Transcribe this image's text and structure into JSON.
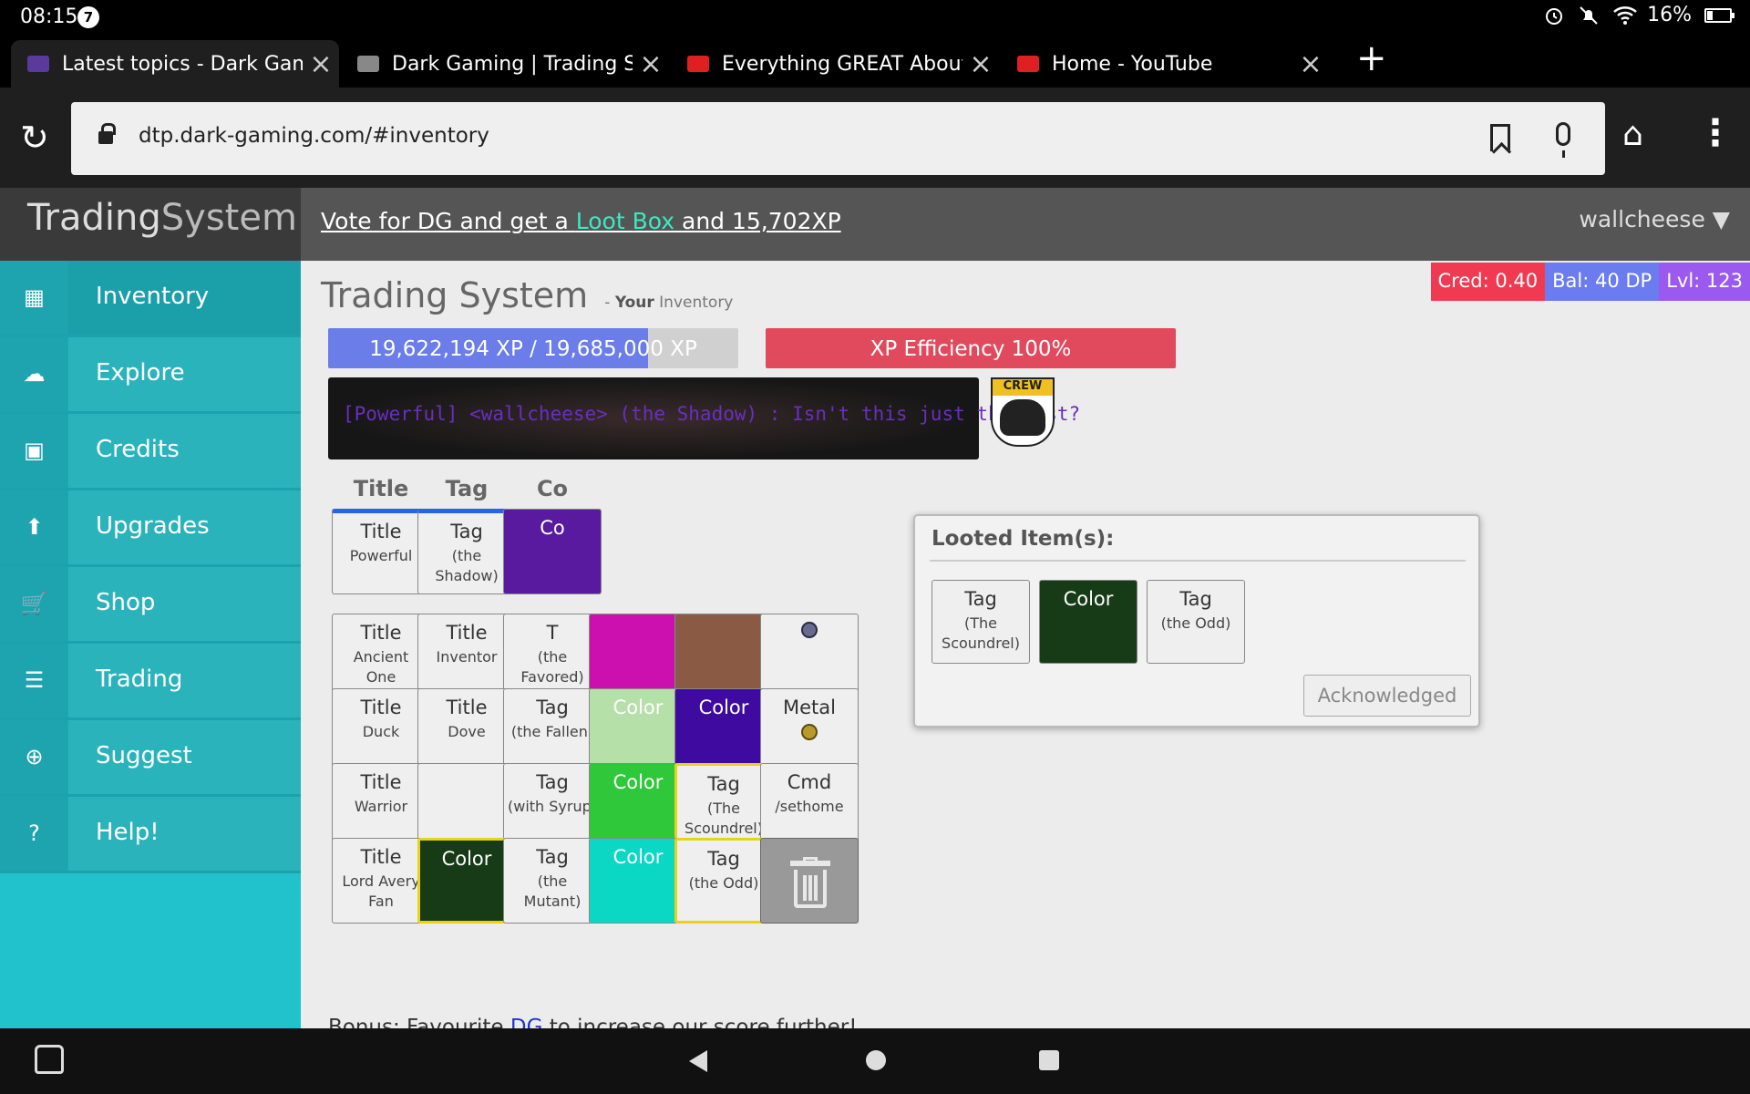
{
  "status": {
    "time": "08:15",
    "notif_count": "7",
    "battery": "16%"
  },
  "tabs": [
    {
      "title": "Latest topics - Dark Gaming",
      "fav_color": "#5a3a9a"
    },
    {
      "title": "Dark Gaming | Trading System",
      "fav_color": "#888888"
    },
    {
      "title": "Everything GREAT About Johnny",
      "fav_color": "#e02020"
    },
    {
      "title": "Home - YouTube",
      "fav_color": "#e02020"
    }
  ],
  "url": "dtp.dark-gaming.com/#inventory",
  "brand": {
    "part1": "Trading",
    "part2": "System"
  },
  "vote": {
    "pre": "Vote for DG and get a ",
    "loot": "Loot Box",
    "post": " and 15,702XP"
  },
  "user": "wallcheese ▼",
  "badges": [
    {
      "text": "Cred: 0.40",
      "color": "#f03a52"
    },
    {
      "text": "Bal: 40 DP",
      "color": "#6a7cf0"
    },
    {
      "text": "Lvl: 123",
      "color": "#9a5af0"
    }
  ],
  "heading": {
    "title": "Trading System",
    "dash": "- ",
    "your": "Your",
    "sub": " Inventory"
  },
  "nav": [
    {
      "label": "Inventory",
      "icon": "▦"
    },
    {
      "label": "Explore",
      "icon": "☁"
    },
    {
      "label": "Credits",
      "icon": "▣"
    },
    {
      "label": "Upgrades",
      "icon": "⬆"
    },
    {
      "label": "Shop",
      "icon": "🛒"
    },
    {
      "label": "Trading",
      "icon": "☰"
    },
    {
      "label": "Suggest",
      "icon": "⊕"
    },
    {
      "label": "Help!",
      "icon": "?"
    }
  ],
  "xp": {
    "text": "19,622,194 XP / 19,685,000 XP",
    "progress": 0.78
  },
  "efficiency": "XP Efficiency 100%",
  "chat": "[Powerful] <wallcheese> (the Shadow) : Isn't this just the best?",
  "crew_label": "CREW",
  "columns": [
    "Title",
    "Tag",
    "Co"
  ],
  "equipped": [
    {
      "l1": "Title",
      "l2": "Powerful"
    },
    {
      "l1": "Tag",
      "l2": "(the Shadow)"
    },
    {
      "l1": "Co",
      "l2": "",
      "bg": "#5a1aa0"
    }
  ],
  "grid": [
    [
      {
        "l1": "Title",
        "l2": "Ancient One"
      },
      {
        "l1": "Title",
        "l2": "Inventor"
      },
      {
        "l1": "T",
        "l2": "(the Favored)"
      },
      {
        "l1": "",
        "l2": "",
        "bg": "#cc10b0"
      },
      {
        "l1": "",
        "l2": "",
        "bg": "#8a5a44"
      },
      {
        "l1": "",
        "l2": "",
        "metal": "blue"
      }
    ],
    [
      {
        "l1": "Title",
        "l2": "Duck"
      },
      {
        "l1": "Title",
        "l2": "Dove"
      },
      {
        "l1": "Tag",
        "l2": "(the Fallen)"
      },
      {
        "l1": "Color",
        "l2": "",
        "bg": "#b5e0a8"
      },
      {
        "l1": "Color",
        "l2": "",
        "bg": "#3f0aa0"
      },
      {
        "l1": "Metal",
        "l2": "",
        "metal": "gold"
      }
    ],
    [
      {
        "l1": "Title",
        "l2": "Warrior"
      },
      {
        "l1": "",
        "l2": ""
      },
      {
        "l1": "Tag",
        "l2": "(with Syrup)"
      },
      {
        "l1": "Color",
        "l2": "",
        "bg": "#2ec83a"
      },
      {
        "l1": "Tag",
        "l2": "(The Scoundrel)",
        "gold": true
      },
      {
        "l1": "Cmd",
        "l2": "/sethome"
      }
    ],
    [
      {
        "l1": "Title",
        "l2": "Lord Avery Fan"
      },
      {
        "l1": "Color",
        "l2": "",
        "bg": "#173a17",
        "gold": true
      },
      {
        "l1": "Tag",
        "l2": "(the Mutant)"
      },
      {
        "l1": "Color",
        "l2": "",
        "bg": "#0ad8c4"
      },
      {
        "l1": "Tag",
        "l2": "(the Odd)",
        "gold": true
      },
      {
        "l1": "",
        "l2": "",
        "trash": true
      }
    ]
  ],
  "modal": {
    "title": "Looted Item(s):",
    "items": [
      {
        "l1": "Tag",
        "l2": "(The Scoundrel)"
      },
      {
        "l1": "Color",
        "l2": "",
        "bg": "#173a17"
      },
      {
        "l1": "Tag",
        "l2": "(the Odd)"
      }
    ],
    "button": "Acknowledged"
  },
  "bonus": {
    "pre": "Bonus: Favourite ",
    "link": "DG",
    "post": " to increase our score further!"
  }
}
